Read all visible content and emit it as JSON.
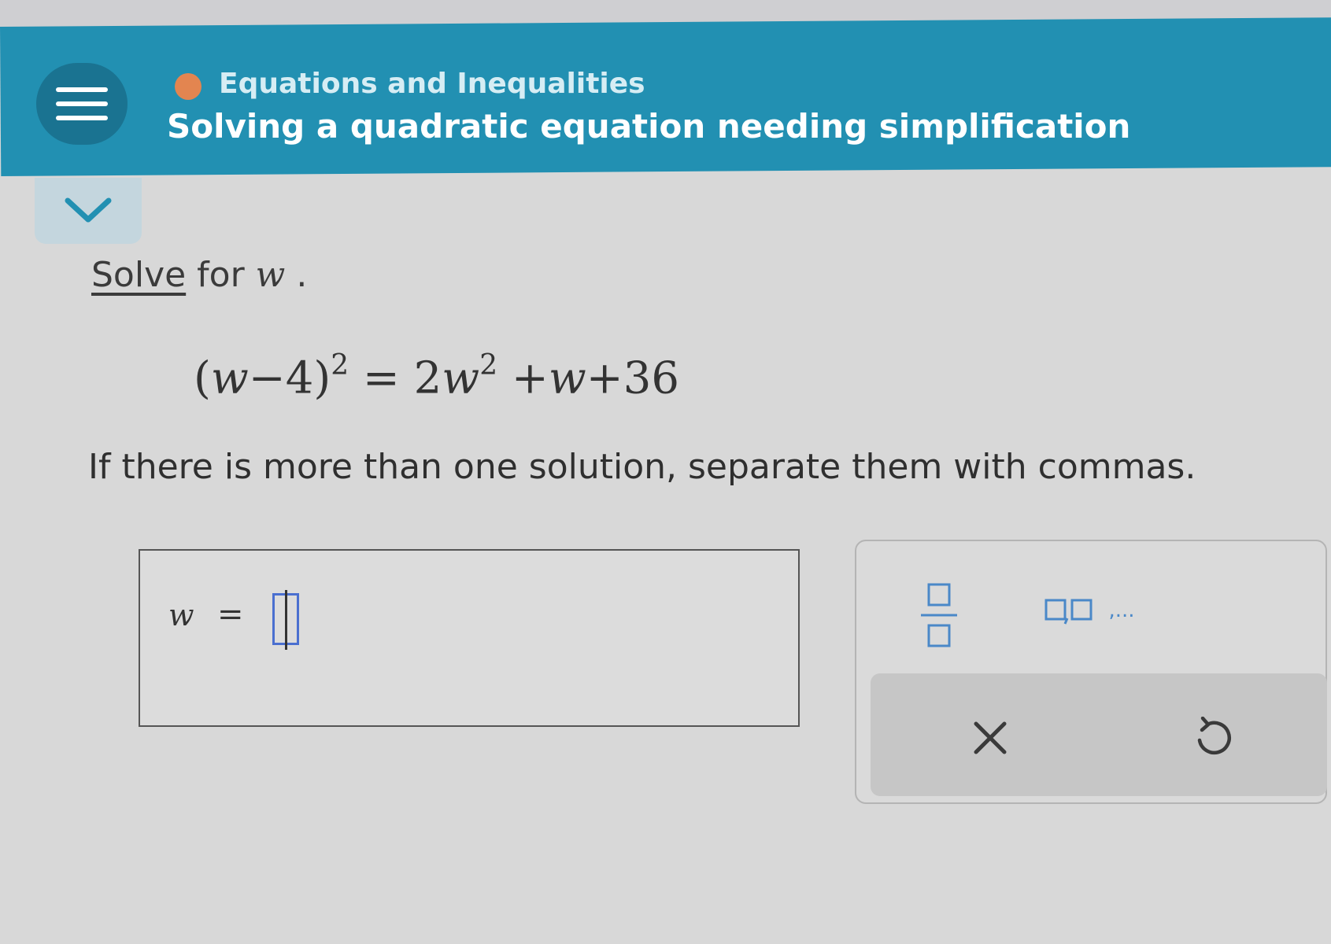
{
  "colors": {
    "header_bg": "#2290b2",
    "menu_btn_bg": "#1a7391",
    "topic_dot": "#e38550",
    "input_border": "#4a6fd0"
  },
  "header": {
    "menu_icon": "hamburger-menu-icon",
    "topic": "Equations and Inequalities",
    "title": "Solving a quadratic equation needing simplification",
    "collapse_icon": "chevron-down-icon"
  },
  "problem": {
    "prompt_link": "Solve",
    "prompt_text": " for ",
    "prompt_var": "w",
    "prompt_end": " .",
    "equation": {
      "lhs_open": "(",
      "lhs_var": "w",
      "lhs_rest": "−4)",
      "lhs_exp": "2",
      "eq": " = 2",
      "rhs_var1": "w",
      "rhs_exp": "2",
      "rhs_mid": " +",
      "rhs_var2": "w",
      "rhs_tail": "+36"
    },
    "instruction": "If there is more than one solution, separate them with commas."
  },
  "answer": {
    "variable": "w",
    "equals": "=",
    "value": ""
  },
  "keypad": {
    "fraction_icon": "fraction-template-icon",
    "list_icon": "comma-list-template-icon",
    "list_suffix": ",...",
    "clear_icon": "clear-x-icon",
    "undo_icon": "undo-icon"
  }
}
